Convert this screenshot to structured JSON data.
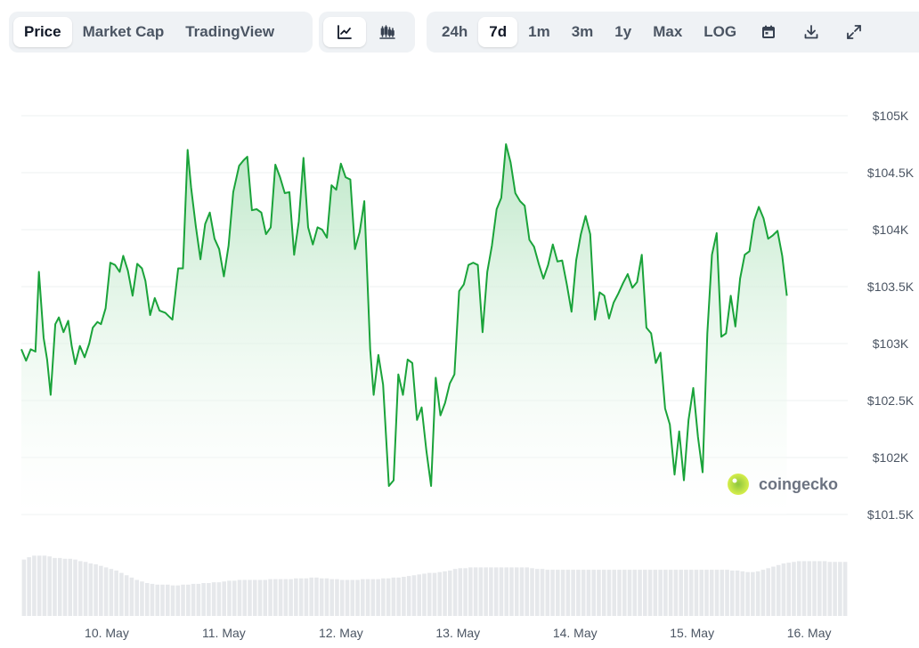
{
  "toolbar": {
    "metric_tabs": [
      {
        "label": "Price",
        "active": true
      },
      {
        "label": "Market Cap",
        "active": false
      },
      {
        "label": "TradingView",
        "active": false
      }
    ],
    "chart_type_buttons": [
      {
        "icon": "line-chart-icon",
        "active": true
      },
      {
        "icon": "candlestick-chart-icon",
        "active": false
      }
    ],
    "range_buttons": [
      {
        "label": "24h",
        "active": false
      },
      {
        "label": "7d",
        "active": true
      },
      {
        "label": "1m",
        "active": false
      },
      {
        "label": "3m",
        "active": false
      },
      {
        "label": "1y",
        "active": false
      },
      {
        "label": "Max",
        "active": false
      },
      {
        "label": "LOG",
        "active": false
      }
    ],
    "utility_icons": [
      "calendar-icon",
      "download-icon",
      "expand-icon"
    ]
  },
  "watermark": "coingecko",
  "colors": {
    "line": "#1aa33a",
    "area_top": "#b9e6c4",
    "area_bottom": "#ffffff",
    "volume": "#e6e8eb",
    "grid": "#edf0f2"
  },
  "chart_data": {
    "type": "line",
    "x_tick_labels": [
      "10. May",
      "11. May",
      "12. May",
      "13. May",
      "14. May",
      "15. May",
      "16. May"
    ],
    "y_tick_labels": [
      "$105K",
      "$104.5K",
      "$104K",
      "$103.5K",
      "$103K",
      "$102.5K",
      "$102K",
      "$101.5K"
    ],
    "y_ticks": [
      105000,
      104500,
      104000,
      103500,
      103000,
      102500,
      102000,
      101500
    ],
    "ylim": [
      101500,
      105000
    ],
    "x_range_days": [
      9.27,
      16.33
    ],
    "series": [
      {
        "values": [
          [
            9.27,
            102950
          ],
          [
            9.31,
            102850
          ],
          [
            9.35,
            102950
          ],
          [
            9.39,
            102930
          ],
          [
            9.42,
            103630
          ],
          [
            9.46,
            103050
          ],
          [
            9.49,
            102860
          ],
          [
            9.52,
            102550
          ],
          [
            9.56,
            103170
          ],
          [
            9.59,
            103230
          ],
          [
            9.63,
            103100
          ],
          [
            9.67,
            103200
          ],
          [
            9.7,
            102980
          ],
          [
            9.73,
            102820
          ],
          [
            9.77,
            102980
          ],
          [
            9.81,
            102880
          ],
          [
            9.85,
            103000
          ],
          [
            9.88,
            103140
          ],
          [
            9.92,
            103190
          ],
          [
            9.95,
            103170
          ],
          [
            9.99,
            103310
          ],
          [
            10.03,
            103710
          ],
          [
            10.07,
            103690
          ],
          [
            10.11,
            103630
          ],
          [
            10.14,
            103770
          ],
          [
            10.18,
            103640
          ],
          [
            10.22,
            103420
          ],
          [
            10.26,
            103700
          ],
          [
            10.3,
            103660
          ],
          [
            10.33,
            103550
          ],
          [
            10.37,
            103250
          ],
          [
            10.41,
            103400
          ],
          [
            10.45,
            103290
          ],
          [
            10.5,
            103270
          ],
          [
            10.53,
            103240
          ],
          [
            10.56,
            103210
          ],
          [
            10.61,
            103660
          ],
          [
            10.65,
            103660
          ],
          [
            10.69,
            104700
          ],
          [
            10.72,
            104370
          ],
          [
            10.76,
            104030
          ],
          [
            10.8,
            103740
          ],
          [
            10.84,
            104050
          ],
          [
            10.88,
            104150
          ],
          [
            10.92,
            103920
          ],
          [
            10.96,
            103830
          ],
          [
            11.0,
            103590
          ],
          [
            11.04,
            103860
          ],
          [
            11.08,
            104330
          ],
          [
            11.13,
            104560
          ],
          [
            11.17,
            104610
          ],
          [
            11.2,
            104640
          ],
          [
            11.24,
            104170
          ],
          [
            11.28,
            104180
          ],
          [
            11.32,
            104150
          ],
          [
            11.36,
            103960
          ],
          [
            11.4,
            104020
          ],
          [
            11.44,
            104570
          ],
          [
            11.48,
            104460
          ],
          [
            11.52,
            104320
          ],
          [
            11.56,
            104330
          ],
          [
            11.6,
            103780
          ],
          [
            11.64,
            104070
          ],
          [
            11.68,
            104630
          ],
          [
            11.72,
            104020
          ],
          [
            11.76,
            103870
          ],
          [
            11.8,
            104020
          ],
          [
            11.84,
            104000
          ],
          [
            11.88,
            103930
          ],
          [
            11.92,
            104390
          ],
          [
            11.96,
            104350
          ],
          [
            12.0,
            104580
          ],
          [
            12.04,
            104460
          ],
          [
            12.08,
            104440
          ],
          [
            12.12,
            103830
          ],
          [
            12.16,
            103980
          ],
          [
            12.2,
            104250
          ],
          [
            12.25,
            102950
          ],
          [
            12.28,
            102550
          ],
          [
            12.32,
            102900
          ],
          [
            12.36,
            102640
          ],
          [
            12.41,
            101750
          ],
          [
            12.45,
            101800
          ],
          [
            12.49,
            102730
          ],
          [
            12.53,
            102550
          ],
          [
            12.57,
            102860
          ],
          [
            12.61,
            102830
          ],
          [
            12.65,
            102330
          ],
          [
            12.69,
            102440
          ],
          [
            12.73,
            102060
          ],
          [
            12.77,
            101750
          ],
          [
            12.81,
            102700
          ],
          [
            12.85,
            102370
          ],
          [
            12.89,
            102480
          ],
          [
            12.93,
            102650
          ],
          [
            12.97,
            102730
          ],
          [
            13.01,
            103460
          ],
          [
            13.05,
            103520
          ],
          [
            13.09,
            103690
          ],
          [
            13.13,
            103710
          ],
          [
            13.17,
            103690
          ],
          [
            13.21,
            103100
          ],
          [
            13.25,
            103630
          ],
          [
            13.29,
            103860
          ],
          [
            13.33,
            104180
          ],
          [
            13.37,
            104280
          ],
          [
            13.41,
            104750
          ],
          [
            13.45,
            104590
          ],
          [
            13.49,
            104320
          ],
          [
            13.53,
            104250
          ],
          [
            13.57,
            104210
          ],
          [
            13.61,
            103910
          ],
          [
            13.65,
            103850
          ],
          [
            13.69,
            103700
          ],
          [
            13.73,
            103570
          ],
          [
            13.77,
            103690
          ],
          [
            13.81,
            103870
          ],
          [
            13.85,
            103720
          ],
          [
            13.89,
            103730
          ],
          [
            13.93,
            103520
          ],
          [
            13.97,
            103280
          ],
          [
            14.01,
            103730
          ],
          [
            14.05,
            103960
          ],
          [
            14.09,
            104120
          ],
          [
            14.13,
            103960
          ],
          [
            14.17,
            103210
          ],
          [
            14.21,
            103450
          ],
          [
            14.25,
            103420
          ],
          [
            14.29,
            103220
          ],
          [
            14.33,
            103360
          ],
          [
            14.37,
            103440
          ],
          [
            14.41,
            103530
          ],
          [
            14.45,
            103610
          ],
          [
            14.49,
            103490
          ],
          [
            14.53,
            103540
          ],
          [
            14.57,
            103780
          ],
          [
            14.61,
            103140
          ],
          [
            14.65,
            103090
          ],
          [
            14.69,
            102830
          ],
          [
            14.73,
            102920
          ],
          [
            14.77,
            102430
          ],
          [
            14.81,
            102290
          ],
          [
            14.85,
            101850
          ],
          [
            14.89,
            102230
          ],
          [
            14.93,
            101800
          ],
          [
            14.97,
            102330
          ],
          [
            15.01,
            102610
          ],
          [
            15.05,
            102180
          ],
          [
            15.09,
            101870
          ],
          [
            15.13,
            103090
          ],
          [
            15.17,
            103780
          ],
          [
            15.21,
            103970
          ],
          [
            15.25,
            103060
          ],
          [
            15.29,
            103090
          ],
          [
            15.33,
            103420
          ],
          [
            15.37,
            103150
          ],
          [
            15.41,
            103570
          ],
          [
            15.45,
            103780
          ],
          [
            15.49,
            103810
          ],
          [
            15.53,
            104080
          ],
          [
            15.57,
            104200
          ],
          [
            15.61,
            104100
          ],
          [
            15.65,
            103920
          ],
          [
            15.69,
            103950
          ],
          [
            15.73,
            103990
          ],
          [
            15.77,
            103770
          ],
          [
            15.81,
            103420
          ]
        ]
      }
    ],
    "volume": [
      0.72,
      0.75,
      0.77,
      0.77,
      0.77,
      0.76,
      0.74,
      0.74,
      0.73,
      0.73,
      0.72,
      0.7,
      0.69,
      0.67,
      0.66,
      0.64,
      0.62,
      0.6,
      0.58,
      0.55,
      0.52,
      0.49,
      0.46,
      0.44,
      0.42,
      0.41,
      0.4,
      0.4,
      0.4,
      0.39,
      0.39,
      0.4,
      0.4,
      0.41,
      0.41,
      0.42,
      0.42,
      0.43,
      0.43,
      0.44,
      0.45,
      0.45,
      0.46,
      0.46,
      0.46,
      0.46,
      0.46,
      0.46,
      0.47,
      0.47,
      0.47,
      0.47,
      0.47,
      0.48,
      0.48,
      0.48,
      0.49,
      0.49,
      0.48,
      0.48,
      0.47,
      0.47,
      0.46,
      0.46,
      0.46,
      0.46,
      0.47,
      0.47,
      0.47,
      0.47,
      0.48,
      0.48,
      0.49,
      0.49,
      0.5,
      0.51,
      0.52,
      0.53,
      0.54,
      0.55,
      0.55,
      0.56,
      0.57,
      0.58,
      0.6,
      0.61,
      0.61,
      0.62,
      0.62,
      0.62,
      0.62,
      0.62,
      0.62,
      0.62,
      0.62,
      0.62,
      0.62,
      0.62,
      0.62,
      0.61,
      0.6,
      0.6,
      0.59,
      0.59,
      0.59,
      0.59,
      0.59,
      0.59,
      0.59,
      0.59,
      0.59,
      0.59,
      0.59,
      0.59,
      0.59,
      0.59,
      0.59,
      0.59,
      0.59,
      0.59,
      0.59,
      0.59,
      0.59,
      0.59,
      0.59,
      0.59,
      0.59,
      0.59,
      0.59,
      0.59,
      0.59,
      0.59,
      0.59,
      0.59,
      0.59,
      0.59,
      0.59,
      0.59,
      0.58,
      0.58,
      0.57,
      0.56,
      0.56,
      0.57,
      0.59,
      0.61,
      0.63,
      0.65,
      0.67,
      0.68,
      0.69,
      0.7,
      0.7,
      0.7,
      0.7,
      0.7,
      0.7,
      0.69,
      0.69,
      0.69,
      0.69
    ]
  }
}
